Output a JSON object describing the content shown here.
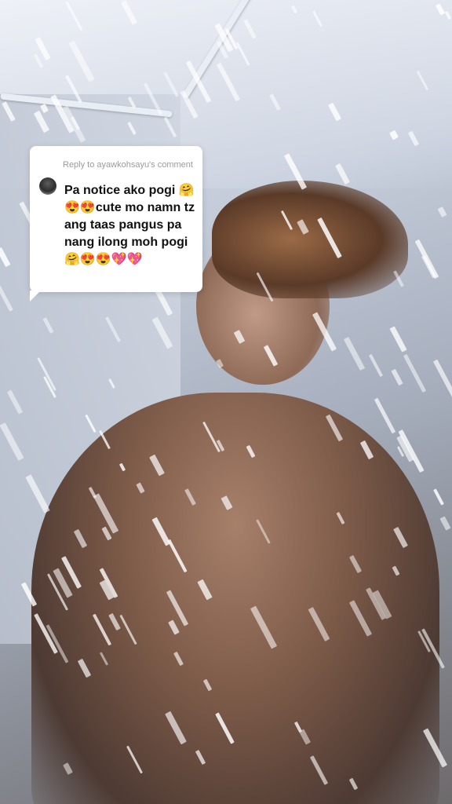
{
  "reply_card": {
    "header": "Reply to ayawkohsayu's comment",
    "comment": "Pa notice ako pogi 🤗😍😍cute mo namn tz ang taas pangus pa nang ilong moh pogi 🤗😍😍💖💖"
  },
  "colors": {
    "card_bg": "#ffffff",
    "header_text": "#9a9a9a",
    "comment_text": "#111111"
  },
  "icons": {
    "avatar": "user-avatar-icon"
  }
}
